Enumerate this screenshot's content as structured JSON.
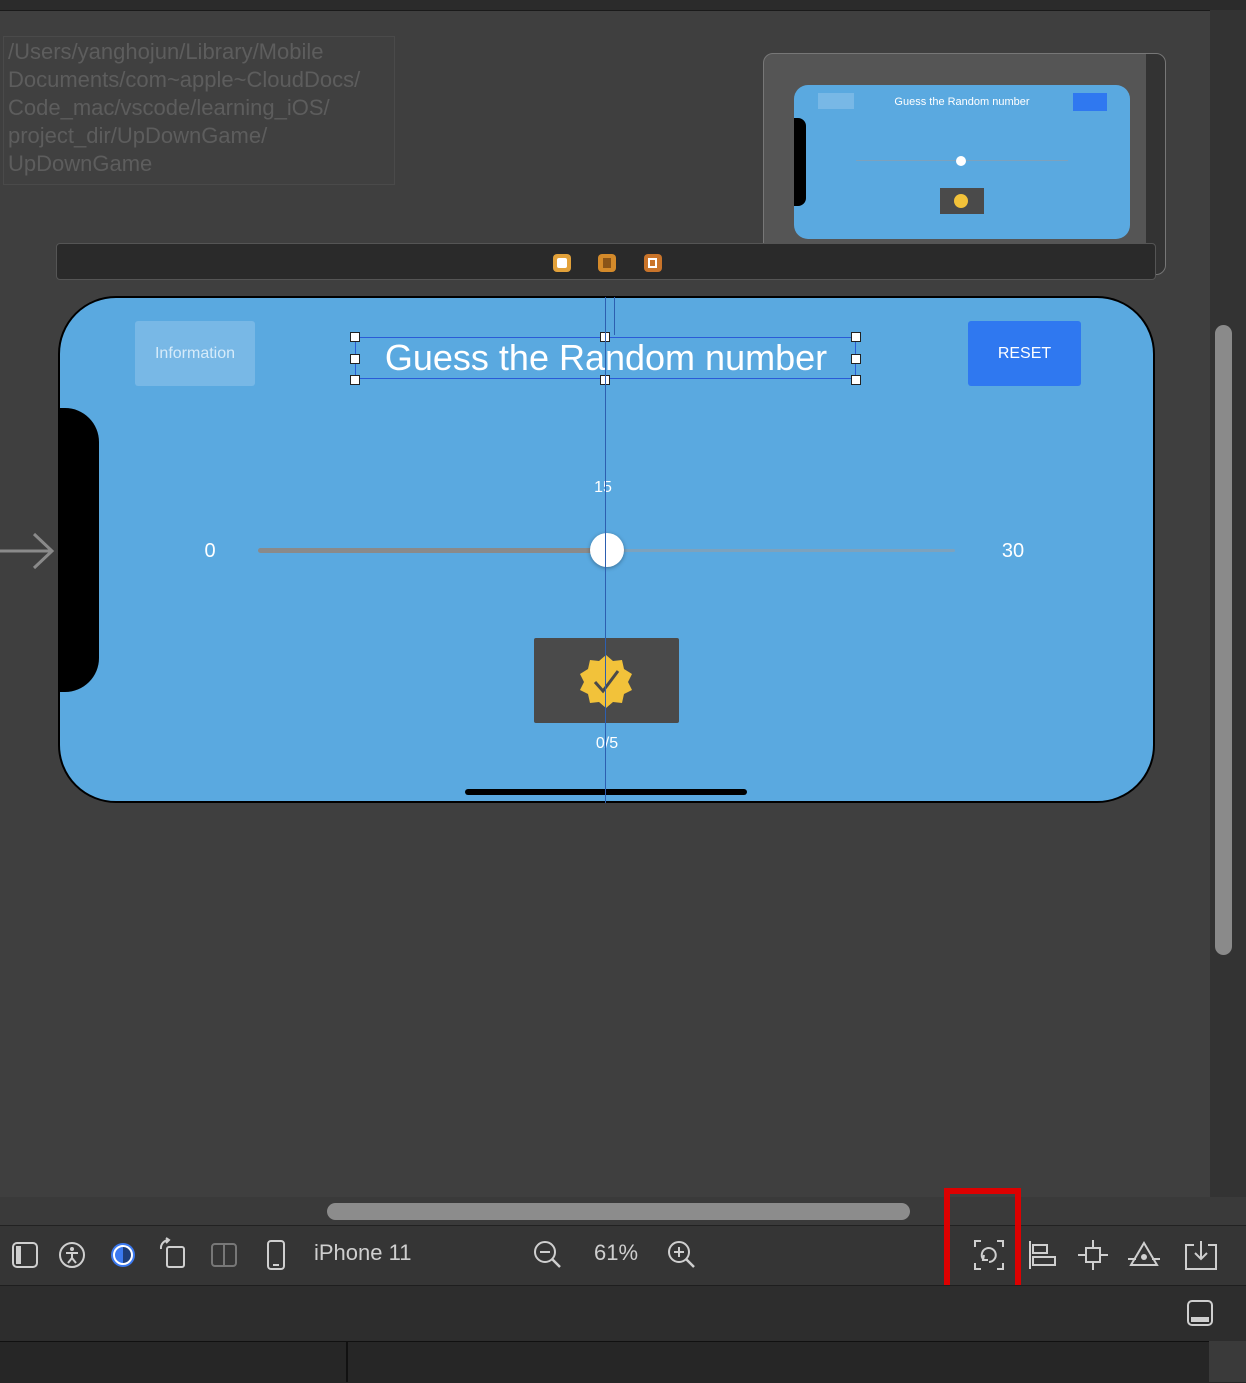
{
  "file_path": "/Users/yanghojun/Library/Mobile\nDocuments/com~apple~CloudDocs/\nCode_mac/vscode/learning_iOS/\nproject_dir/UpDownGame/\nUpDownGame",
  "colors": {
    "view_bg": "#5aa9e0",
    "selection": "#2a5bd7",
    "highlight": "#dd0000",
    "accent": "#2f78f0"
  },
  "scene": {
    "dock_icons": [
      "view-controller-icon",
      "first-responder-icon",
      "exit-icon"
    ],
    "info_button": "Information",
    "reset_button": "RESET",
    "title": "Guess the Random number",
    "slider": {
      "value_label": "15",
      "min_label": "0",
      "max_label": "30",
      "value": 15,
      "min": 0,
      "max": 30
    },
    "count_label": "0/5",
    "hit_icon": "checkmark-seal-icon"
  },
  "toolbar": {
    "icons": [
      "sidebar-icon",
      "accessibility-icon",
      "appearance-icon",
      "rotate-icon",
      "split-icon",
      "device-icon"
    ],
    "device": "iPhone 11",
    "zoom": "61%",
    "right_icons": [
      "update-frames-icon",
      "align-icon",
      "add-constraints-icon",
      "resolve-issues-icon",
      "embed-in-icon"
    ]
  },
  "bottom_bar": {
    "icon": "panel-toggle-icon"
  }
}
